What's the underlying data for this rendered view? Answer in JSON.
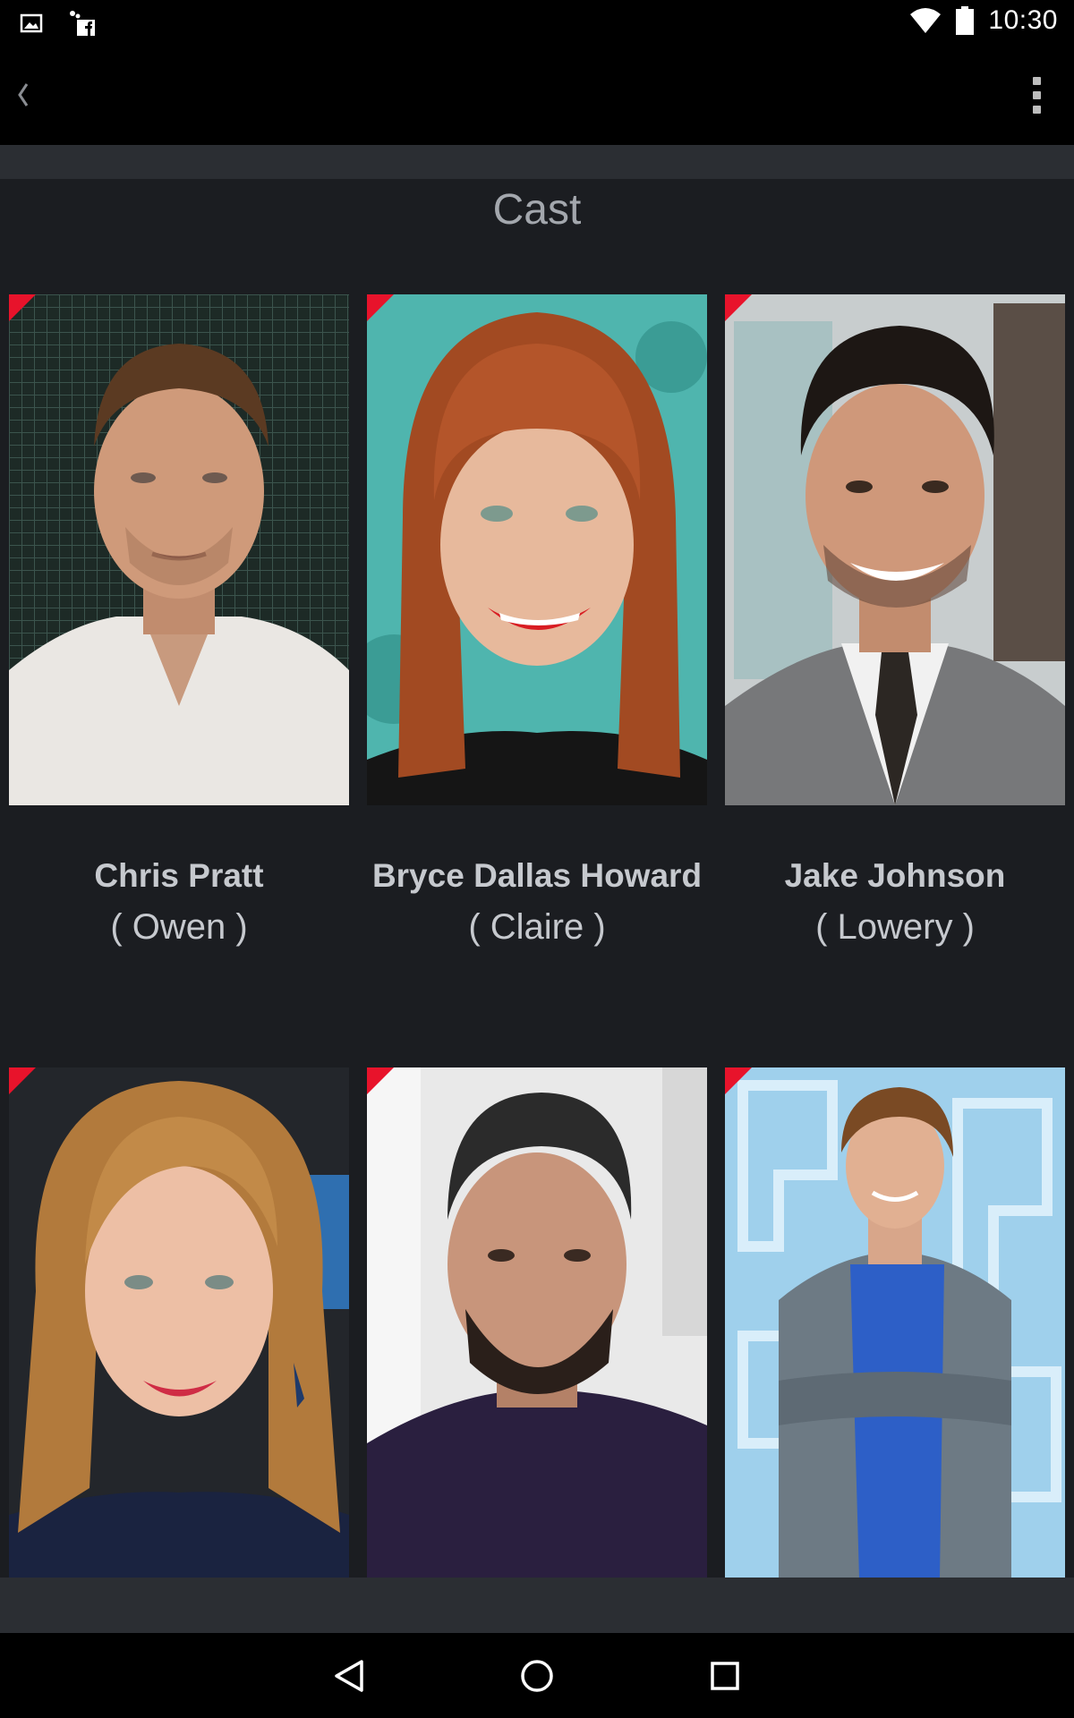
{
  "status_bar": {
    "time": "10:30",
    "icons": [
      "image-notification-icon",
      "facebook-notification-icon",
      "wifi-icon",
      "battery-icon"
    ]
  },
  "app_bar": {
    "back_icon": "back-chevron-icon",
    "menu_icon": "overflow-menu-icon"
  },
  "section": {
    "title": "Cast"
  },
  "cast": [
    {
      "name": "Chris Pratt",
      "role": "( Owen )"
    },
    {
      "name": "Bryce Dallas Howard",
      "role": "( Claire )"
    },
    {
      "name": "Jake Johnson",
      "role": "( Lowery )"
    },
    {
      "name": "",
      "role": ""
    },
    {
      "name": "",
      "role": ""
    },
    {
      "name": "",
      "role": ""
    }
  ],
  "nav_bar": {
    "icons": [
      "nav-back-icon",
      "nav-home-icon",
      "nav-recents-icon"
    ]
  },
  "colors": {
    "background": "#1b1d21",
    "bar": "#000000",
    "band": "#2b2e33",
    "accent_flag": "#e8132b",
    "text": "#c6c9ce"
  }
}
